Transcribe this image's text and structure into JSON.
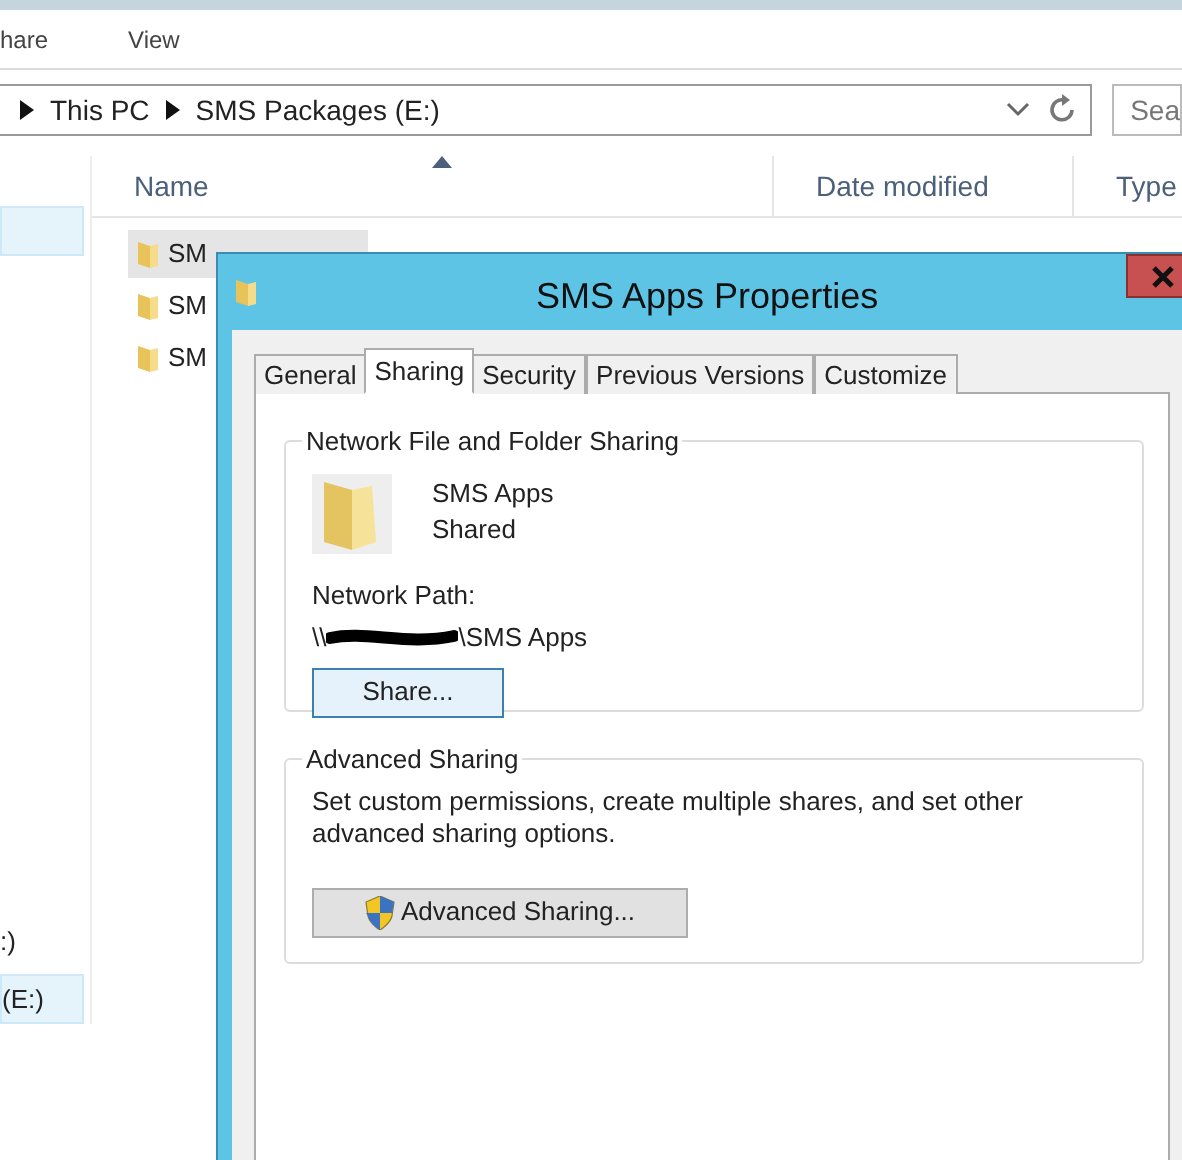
{
  "explorer": {
    "ribbon_tabs": [
      "hare",
      "View"
    ],
    "address": {
      "crumbs": [
        "This PC",
        "SMS Packages (E:)"
      ]
    },
    "search": {
      "placeholder": "Sea"
    },
    "columns": [
      {
        "label": "Name",
        "sorted": true
      },
      {
        "label": "Date modified",
        "sorted": false
      },
      {
        "label": "Type",
        "sorted": false
      }
    ],
    "files": [
      {
        "name": "SM",
        "selected": true
      },
      {
        "name": "SM",
        "selected": false
      },
      {
        "name": "SM",
        "selected": false
      }
    ],
    "nav_items": [
      {
        "selected": true
      },
      {
        "label": ":)",
        "selected": false
      },
      {
        "label": "(E:)",
        "selected": true
      }
    ]
  },
  "dialog": {
    "title": "SMS Apps Properties",
    "tabs": [
      {
        "label": "General",
        "selected": false
      },
      {
        "label": "Sharing",
        "selected": true
      },
      {
        "label": "Security",
        "selected": false
      },
      {
        "label": "Previous Versions",
        "selected": false
      },
      {
        "label": "Customize",
        "selected": false
      }
    ],
    "network_sharing": {
      "heading": "Network File and Folder Sharing",
      "folder_name": "SMS Apps",
      "status": "Shared",
      "path_label": "Network Path:",
      "path_prefix": "\\\\",
      "path_suffix": "\\SMS Apps",
      "button": "Share..."
    },
    "advanced_sharing": {
      "heading": "Advanced Sharing",
      "description": "Set custom permissions, create multiple shares, and set other advanced sharing options.",
      "button": "Advanced Sharing..."
    }
  }
}
